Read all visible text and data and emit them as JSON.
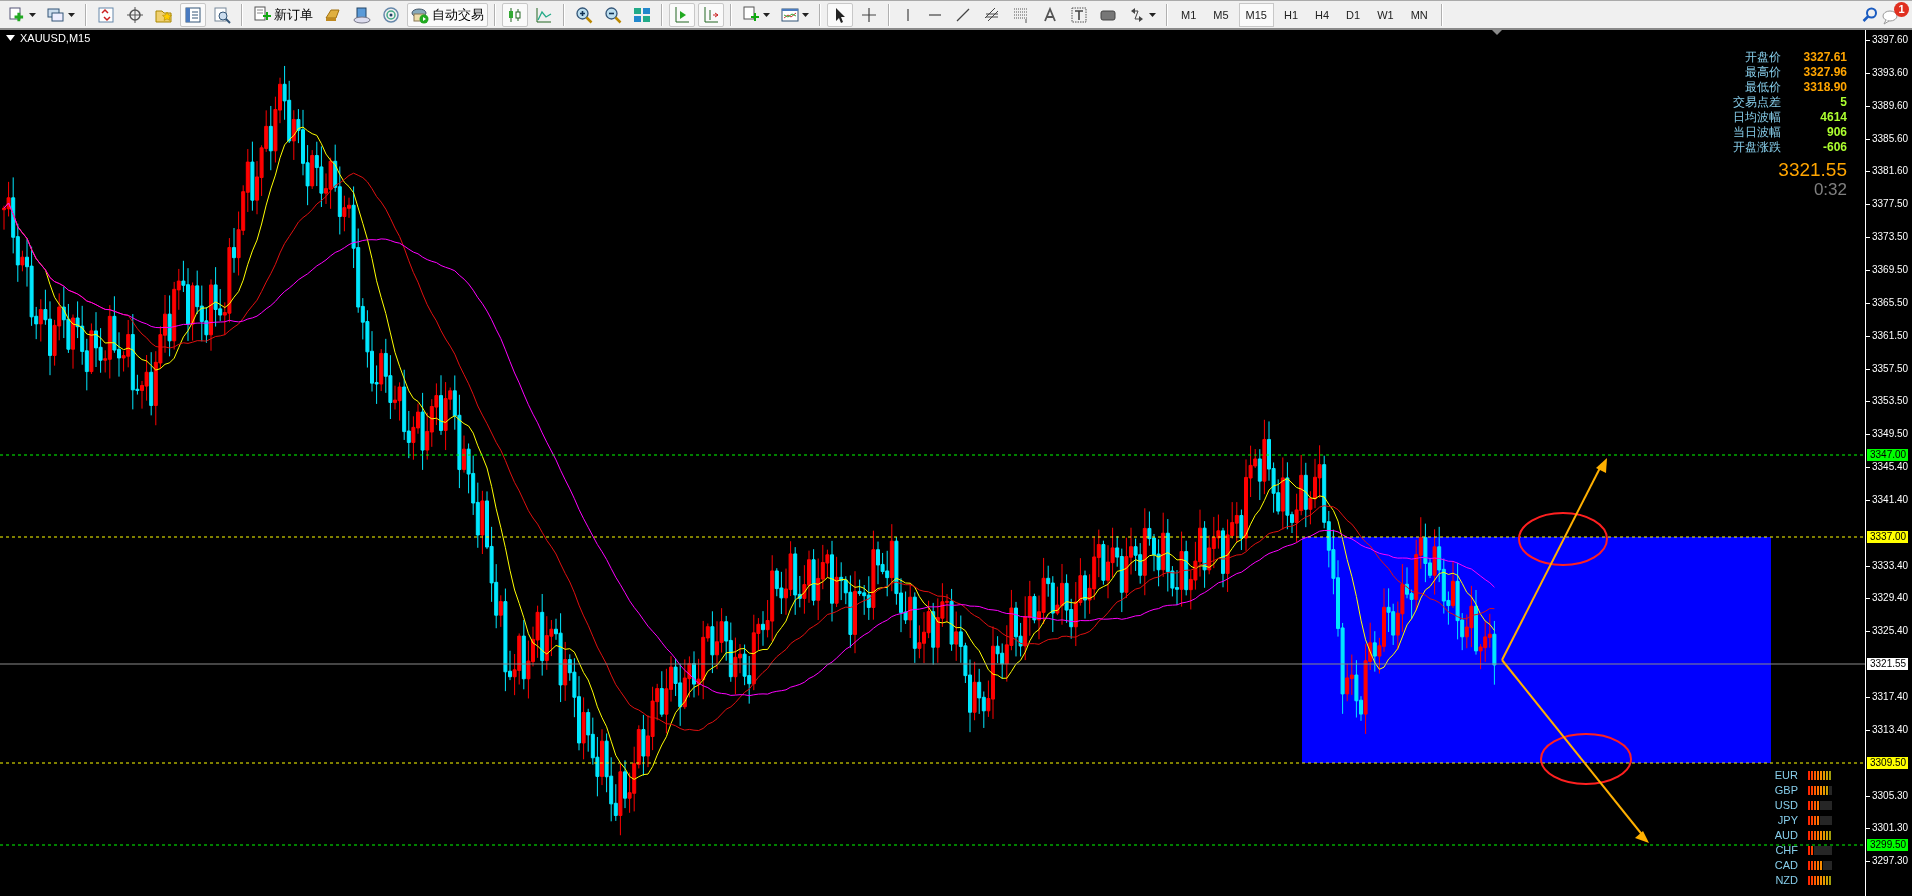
{
  "toolbar": {
    "items": [
      {
        "kind": "new-chart",
        "pressed": false
      },
      {
        "kind": "profiles",
        "pressed": false
      },
      {
        "kind": "separator"
      },
      {
        "kind": "market-watch",
        "pressed": false
      },
      {
        "kind": "data-window",
        "pressed": false
      },
      {
        "kind": "navigator",
        "pressed": false
      },
      {
        "kind": "terminal",
        "pressed": true
      },
      {
        "kind": "tester",
        "pressed": false
      },
      {
        "kind": "separator"
      },
      {
        "kind": "new-order",
        "label": "新订单",
        "pressed": false
      },
      {
        "kind": "gold",
        "pressed": false
      },
      {
        "kind": "server",
        "pressed": false
      },
      {
        "kind": "signal",
        "pressed": false
      },
      {
        "kind": "autotrading",
        "label": "自动交易",
        "pressed": true
      },
      {
        "kind": "separator"
      },
      {
        "kind": "bar-chart",
        "pressed": true
      },
      {
        "kind": "line-chart",
        "pressed": false
      },
      {
        "kind": "separator"
      },
      {
        "kind": "zoom-in",
        "pressed": false
      },
      {
        "kind": "zoom-out",
        "pressed": false
      },
      {
        "kind": "tile",
        "pressed": false
      },
      {
        "kind": "separator"
      },
      {
        "kind": "auto-scroll",
        "pressed": true
      },
      {
        "kind": "chart-shift",
        "pressed": true
      },
      {
        "kind": "separator"
      },
      {
        "kind": "indicators",
        "pressed": false
      },
      {
        "kind": "templates",
        "pressed": false
      },
      {
        "kind": "separator"
      },
      {
        "kind": "cursor",
        "pressed": true
      },
      {
        "kind": "crosshair",
        "pressed": false
      },
      {
        "kind": "separator"
      },
      {
        "kind": "vline",
        "pressed": false
      },
      {
        "kind": "hline",
        "pressed": false
      },
      {
        "kind": "trendline",
        "pressed": false
      },
      {
        "kind": "channel",
        "pressed": false
      },
      {
        "kind": "fibo",
        "pressed": false
      },
      {
        "kind": "text",
        "pressed": false
      },
      {
        "kind": "label",
        "pressed": false
      },
      {
        "kind": "rectangle",
        "pressed": false
      },
      {
        "kind": "arrows",
        "pressed": false
      },
      {
        "kind": "separator"
      }
    ],
    "timeframes": [
      {
        "label": "M1",
        "selected": false
      },
      {
        "label": "M5",
        "selected": false
      },
      {
        "label": "M15",
        "selected": true
      },
      {
        "label": "H1",
        "selected": false
      },
      {
        "label": "H4",
        "selected": false
      },
      {
        "label": "D1",
        "selected": false
      },
      {
        "label": "W1",
        "selected": false
      },
      {
        "label": "MN",
        "selected": false
      }
    ],
    "notification_count": "1"
  },
  "chart": {
    "title": "XAUUSD,M15",
    "info": [
      {
        "label": "开盘价",
        "value": "3327.61",
        "color": "#ffa500"
      },
      {
        "label": "最高价",
        "value": "3327.96",
        "color": "#ffa500"
      },
      {
        "label": "最低价",
        "value": "3318.90",
        "color": "#ffa500"
      },
      {
        "label": "交易点差",
        "value": "5",
        "color": "#adff2f"
      },
      {
        "label": "日均波幅",
        "value": "4614",
        "color": "#adff2f"
      },
      {
        "label": "当日波幅",
        "value": "906",
        "color": "#adff2f"
      },
      {
        "label": "开盘涨跌",
        "value": "-606",
        "color": "#adff2f"
      }
    ],
    "price": "3321.55",
    "timer": "0:32",
    "axis_ticks": [
      "3397.60",
      "3393.60",
      "3389.60",
      "3385.60",
      "3381.60",
      "3377.50",
      "3373.50",
      "3369.50",
      "3365.50",
      "3361.50",
      "3357.50",
      "3353.50",
      "3349.50",
      "3345.40",
      "3341.40",
      "3333.40",
      "3329.40",
      "3325.40",
      "3317.40",
      "3313.40",
      "3305.30",
      "3301.30",
      "3297.30"
    ],
    "price_levels": [
      {
        "label": "3347.00",
        "color": "#00ff00"
      },
      {
        "label": "3337.00",
        "color": "#ffff00"
      },
      {
        "label": "3309.50",
        "color": "#ffff00"
      },
      {
        "label": "3299.50",
        "color": "#00ff00"
      }
    ],
    "bid_label": "3321.55",
    "currency_strength": [
      {
        "name": "EUR",
        "level": 1
      },
      {
        "name": "GBP",
        "level": 0.875
      },
      {
        "name": "USD",
        "level": 0.5
      },
      {
        "name": "JPY",
        "level": 0.5
      },
      {
        "name": "AUD",
        "level": 1
      },
      {
        "name": "CHF",
        "level": 0.25
      },
      {
        "name": "CAD",
        "level": 0.625
      },
      {
        "name": "NZD",
        "level": 1
      }
    ]
  }
}
